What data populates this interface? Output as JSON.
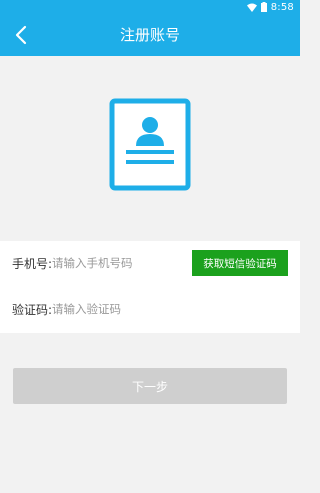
{
  "status_bar": {
    "time": "8:58",
    "wifi_icon": "wifi-icon",
    "battery_icon": "battery-icon"
  },
  "app_bar": {
    "title": "注册账号",
    "back_icon": "chevron-left-icon",
    "color": "#1eaee8"
  },
  "illustration": {
    "icon": "id-card-icon",
    "color": "#1eaee8"
  },
  "form": {
    "phone": {
      "label": "手机号:",
      "placeholder": "请输入手机号码",
      "value": ""
    },
    "sms_button": {
      "label": "获取短信验证码",
      "color": "#1ba11d"
    },
    "code": {
      "label": "验证码:",
      "placeholder": "请输入验证码",
      "value": ""
    }
  },
  "next_button": {
    "label": "下一步",
    "color": "#cfcfcf"
  }
}
